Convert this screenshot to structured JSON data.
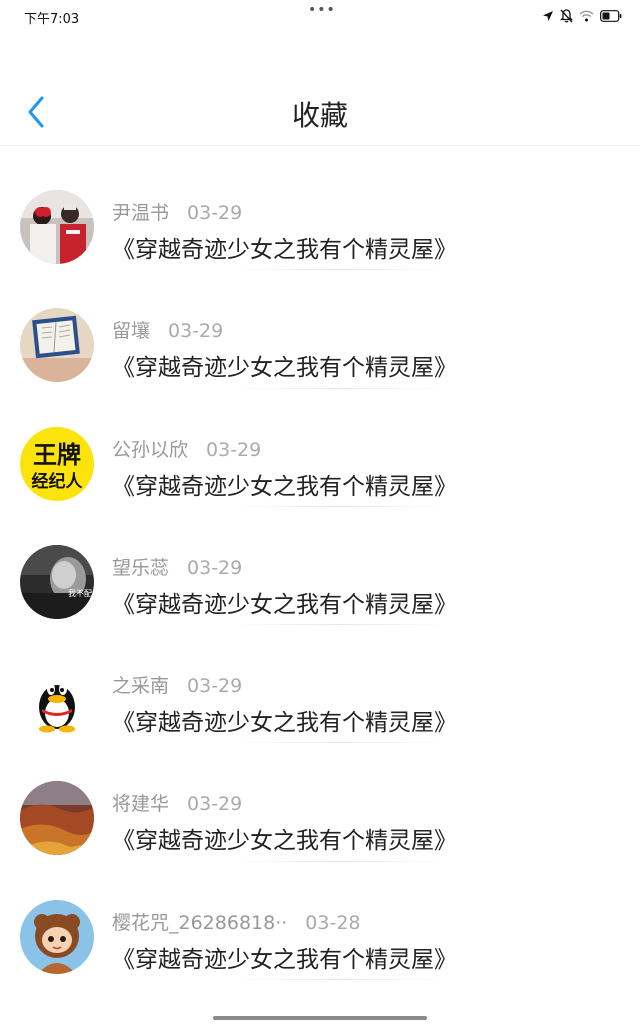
{
  "status_bar": {
    "time": "下午7:03",
    "dots": "•••"
  },
  "header": {
    "title": "收藏",
    "accent_color": "#2196F3"
  },
  "favorites": [
    {
      "username": "尹温书",
      "date": "03-29",
      "book": "《穿越奇迹少女之我有个精灵屋》",
      "avatar": "avatar-couple-photo"
    },
    {
      "username": "留壤",
      "date": "03-29",
      "book": "《穿越奇迹少女之我有个精灵屋》",
      "avatar": "avatar-book-photo"
    },
    {
      "username": "公孙以欣",
      "date": "03-29",
      "book": "《穿越奇迹少女之我有个精灵屋》",
      "avatar": "avatar-yellow-calligraphy",
      "avatar_text_top": "王牌",
      "avatar_text_bottom": "经纪人"
    },
    {
      "username": "望乐蕊",
      "date": "03-29",
      "book": "《穿越奇迹少女之我有个精灵屋》",
      "avatar": "avatar-grayscale-photo",
      "avatar_text": "我不配"
    },
    {
      "username": "之采南",
      "date": "03-29",
      "book": "《穿越奇迹少女之我有个精灵屋》",
      "avatar": "avatar-penguin"
    },
    {
      "username": "将建华",
      "date": "03-29",
      "book": "《穿越奇迹少女之我有个精灵屋》",
      "avatar": "avatar-autumn-landscape"
    },
    {
      "username": "樱花咒_26286818··",
      "date": "03-28",
      "book": "《穿越奇迹少女之我有个精灵屋》",
      "avatar": "avatar-cartoon-girl"
    }
  ]
}
